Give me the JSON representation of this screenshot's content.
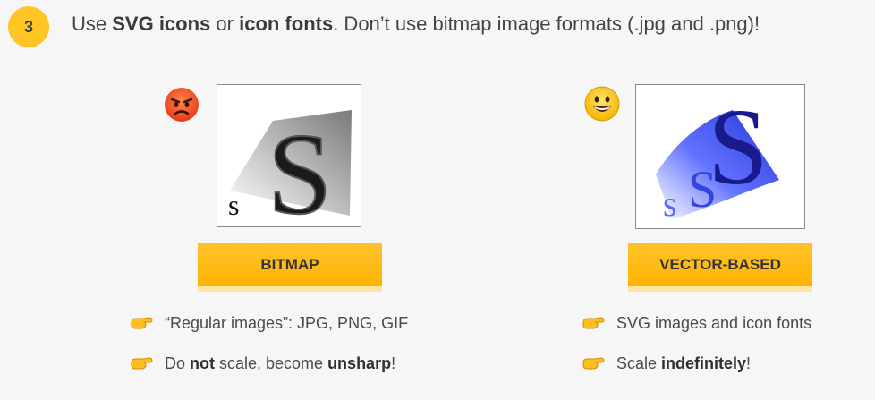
{
  "step_number": "3",
  "headline": {
    "part1": "Use ",
    "svg_icons": "SVG icons",
    "part2": " or ",
    "icon_fonts": "icon fonts",
    "part3": ". Don’t use bitmap image formats (.jpg and .png)!"
  },
  "bitmap": {
    "emoji": "angry-face-emoji",
    "image_small_letter": "s",
    "image_big_letter": "S",
    "label": "BITMAP",
    "bullets": [
      {
        "text": "“Regular images”: JPG, PNG, GIF"
      },
      {
        "pre": "Do ",
        "bold1": "not",
        "mid": " scale, become ",
        "bold2": "unsharp",
        "post": "!"
      }
    ]
  },
  "vector": {
    "emoji": "grinning-face-emoji",
    "image_small_letter": "s",
    "image_mid_letter": "S",
    "image_big_letter": "S",
    "label": "VECTOR-BASED",
    "bullets": [
      {
        "text": "SVG images and icon fonts"
      },
      {
        "pre": "Scale ",
        "bold1": "indefinitely",
        "post": "!"
      }
    ]
  },
  "colors": {
    "accent": "#ffc524",
    "background": "#f6f6f6",
    "vector_blue": "#1a1a8c"
  },
  "icons": {
    "bullet": "pointing-hand-icon"
  }
}
